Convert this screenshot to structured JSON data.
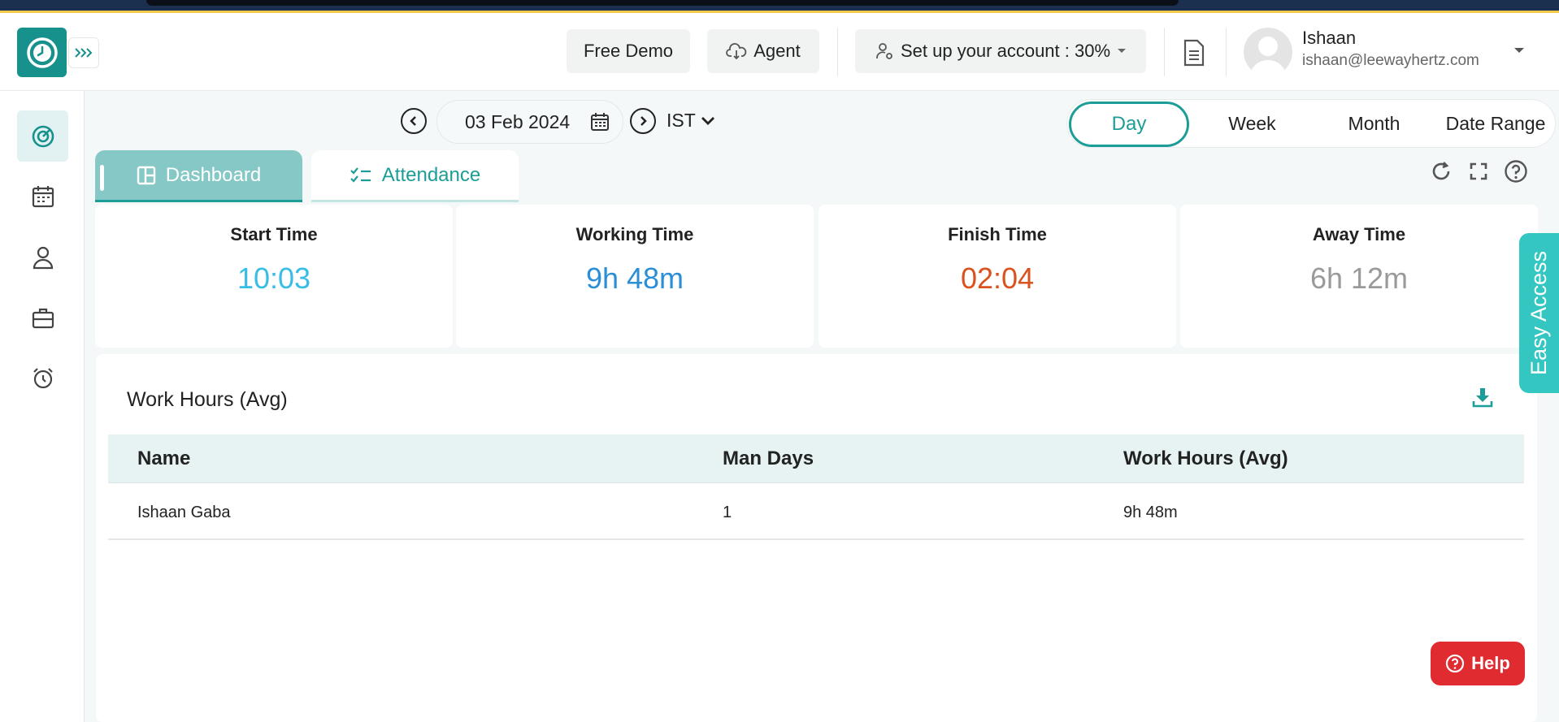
{
  "colors": {
    "accent": "#1d9d97",
    "start": "#38bde6",
    "working": "#2a8fd6",
    "finish": "#d9531e",
    "away": "#9a9a9a",
    "help": "#e02b31"
  },
  "header": {
    "free_demo": "Free Demo",
    "agent": "Agent",
    "setup": "Set up your account : 30%",
    "user_name": "Ishaan",
    "user_email": "ishaan@leewayhertz.com"
  },
  "sidebar": {
    "items": [
      {
        "icon": "target-icon",
        "active": true
      },
      {
        "icon": "calendar-icon",
        "active": false
      },
      {
        "icon": "user-icon",
        "active": false
      },
      {
        "icon": "briefcase-icon",
        "active": false
      },
      {
        "icon": "alarm-clock-icon",
        "active": false
      }
    ]
  },
  "date": {
    "value": "03 Feb 2024",
    "timezone": "IST"
  },
  "range": {
    "options": [
      "Day",
      "Week",
      "Month",
      "Date Range"
    ],
    "selected": "Day"
  },
  "tabs": [
    {
      "label": "Dashboard",
      "active": true
    },
    {
      "label": "Attendance",
      "active": false
    }
  ],
  "cards": [
    {
      "title": "Start Time",
      "value": "10:03"
    },
    {
      "title": "Working Time",
      "value": "9h 48m"
    },
    {
      "title": "Finish Time",
      "value": "02:04"
    },
    {
      "title": "Away Time",
      "value": "6h 12m"
    }
  ],
  "table": {
    "title": "Work Hours (Avg)",
    "columns": [
      "Name",
      "Man Days",
      "Work Hours (Avg)"
    ],
    "rows": [
      [
        "Ishaan Gaba",
        "1",
        "9h 48m"
      ]
    ]
  },
  "easy_access": "Easy Access",
  "help": "Help"
}
